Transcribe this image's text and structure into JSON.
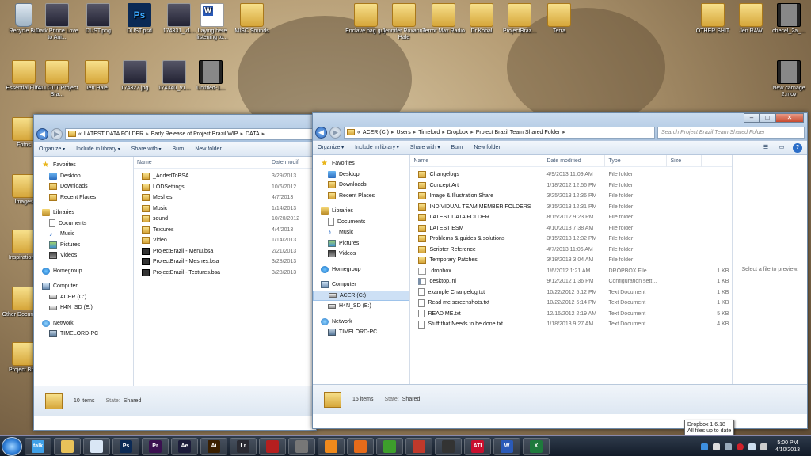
{
  "desktop": {
    "icons": [
      {
        "label": "Recycle Bin"
      },
      {
        "label": "Dark Prince Love to Ani..."
      },
      {
        "label": "DUST.png"
      },
      {
        "label": "DUST.psd"
      },
      {
        "label": "174331_v1..."
      },
      {
        "label": "Laying here listening to..."
      },
      {
        "label": "MISC Sounds"
      },
      {
        "label": "Enclave bag guy"
      },
      {
        "label": "Jennifer Roxanne Hale"
      },
      {
        "label": "Terror Max Radio"
      },
      {
        "label": "Dr.Kobal"
      },
      {
        "label": "ProjectBraz..."
      },
      {
        "label": "Terra"
      },
      {
        "label": "OTHER SHIT"
      },
      {
        "label": "Jen RAW"
      },
      {
        "label": "checel_2a_..."
      },
      {
        "label": "Essential Files"
      },
      {
        "label": "fALLOUT Project Bra..."
      },
      {
        "label": "Jen Hale"
      },
      {
        "label": "174327.jpg"
      },
      {
        "label": "174340_v1..."
      },
      {
        "label": "Untitled-1..."
      },
      {
        "label": "New carnage 2.mov"
      },
      {
        "label": "Fotos"
      },
      {
        "label": "Images"
      },
      {
        "label": "Inspiration..."
      },
      {
        "label": "Other Documents"
      },
      {
        "label": "Project Braz"
      }
    ],
    "psd_badge": "PSD",
    "psd_glyph": "Ps"
  },
  "left_window": {
    "address": [
      "«",
      "LATEST DATA FOLDER",
      "Early Release of Project Brazil WIP",
      "DATA"
    ],
    "toolbar": [
      "Organize",
      "Include in library",
      "Share with",
      "Burn",
      "New folder"
    ],
    "columns": [
      "Name",
      "Date modif"
    ],
    "nav": {
      "favorites": "Favorites",
      "fav_items": [
        "Desktop",
        "Downloads",
        "Recent Places"
      ],
      "libraries": "Libraries",
      "lib_items": [
        "Documents",
        "Music",
        "Pictures",
        "Videos"
      ],
      "homegroup": "Homegroup",
      "computer": "Computer",
      "comp_items": [
        "ACER (C:)",
        "H4N_SD (E:)"
      ],
      "network": "Network",
      "net_items": [
        "TIMELORD-PC"
      ]
    },
    "files": [
      {
        "name": "_AddedToBSA",
        "date": "3/29/2013",
        "kind": "folder"
      },
      {
        "name": "LODSettings",
        "date": "10/6/2012",
        "kind": "folder"
      },
      {
        "name": "Meshes",
        "date": "4/7/2013",
        "kind": "folder"
      },
      {
        "name": "Music",
        "date": "1/14/2013",
        "kind": "folder"
      },
      {
        "name": "sound",
        "date": "10/20/2012",
        "kind": "folder"
      },
      {
        "name": "Textures",
        "date": "4/4/2013",
        "kind": "folder"
      },
      {
        "name": "Video",
        "date": "1/14/2013",
        "kind": "folder"
      },
      {
        "name": "ProjectBrazil - Menu.bsa",
        "date": "2/21/2013",
        "kind": "bsa"
      },
      {
        "name": "ProjectBrazil - Meshes.bsa",
        "date": "3/28/2013",
        "kind": "bsa"
      },
      {
        "name": "ProjectBrazil - Textures.bsa",
        "date": "3/28/2013",
        "kind": "bsa"
      }
    ],
    "status": {
      "count": "10 items",
      "state_label": "State:",
      "state": "Shared"
    }
  },
  "right_window": {
    "address": [
      "«",
      "ACER (C:)",
      "Users",
      "Timelord",
      "Dropbox",
      "Project Brazil Team Shared Folder"
    ],
    "search_placeholder": "Search Project Brazil Team Shared Folder",
    "toolbar": [
      "Organize",
      "Include in library",
      "Share with",
      "Burn",
      "New folder"
    ],
    "columns": [
      "Name",
      "Date modified",
      "Type",
      "Size"
    ],
    "nav": {
      "favorites": "Favorites",
      "fav_items": [
        "Desktop",
        "Downloads",
        "Recent Places"
      ],
      "libraries": "Libraries",
      "lib_items": [
        "Documents",
        "Music",
        "Pictures",
        "Videos"
      ],
      "homegroup": "Homegroup",
      "computer": "Computer",
      "comp_items": [
        "ACER (C:)",
        "H4N_SD (E:)"
      ],
      "network": "Network",
      "net_items": [
        "TIMELORD-PC"
      ]
    },
    "files": [
      {
        "name": "Changelogs",
        "date": "4/9/2013 11:09 AM",
        "type": "File folder",
        "size": "",
        "kind": "folder"
      },
      {
        "name": "Concept Art",
        "date": "1/18/2012 12:56 PM",
        "type": "File folder",
        "size": "",
        "kind": "folder"
      },
      {
        "name": "Image & Illustration Share",
        "date": "3/25/2013 12:36 PM",
        "type": "File folder",
        "size": "",
        "kind": "folder"
      },
      {
        "name": "INDIVIDUAL TEAM MEMBER FOLDERS",
        "date": "3/15/2013 12:31 PM",
        "type": "File folder",
        "size": "",
        "kind": "folder"
      },
      {
        "name": "LATEST DATA FOLDER",
        "date": "8/15/2012 9:23 PM",
        "type": "File folder",
        "size": "",
        "kind": "folder"
      },
      {
        "name": "LATEST ESM",
        "date": "4/10/2013 7:38 AM",
        "type": "File folder",
        "size": "",
        "kind": "folder"
      },
      {
        "name": "Problems & guides & solutions",
        "date": "3/15/2013 12:32 PM",
        "type": "File folder",
        "size": "",
        "kind": "folder"
      },
      {
        "name": "Scripter Reference",
        "date": "4/7/2013 11:06 AM",
        "type": "File folder",
        "size": "",
        "kind": "folder"
      },
      {
        "name": "Temporary Patches",
        "date": "3/18/2013 3:04 AM",
        "type": "File folder",
        "size": "",
        "kind": "folder"
      },
      {
        "name": ".dropbox",
        "date": "1/6/2012 1:21 AM",
        "type": "DROPBOX File",
        "size": "1 KB",
        "kind": "dropbox"
      },
      {
        "name": "desktop.ini",
        "date": "9/12/2012 1:36 PM",
        "type": "Configuration sett...",
        "size": "1 KB",
        "kind": "ini"
      },
      {
        "name": "example Changelog.txt",
        "date": "10/22/2012 5:12 PM",
        "type": "Text Document",
        "size": "1 KB",
        "kind": "txt"
      },
      {
        "name": "Read me screenshots.txt",
        "date": "10/22/2012 5:14 PM",
        "type": "Text Document",
        "size": "1 KB",
        "kind": "txt"
      },
      {
        "name": "READ ME.txt",
        "date": "12/16/2012 2:19 AM",
        "type": "Text Document",
        "size": "5 KB",
        "kind": "txt"
      },
      {
        "name": "Stuff that Needs to be done.txt",
        "date": "1/18/2013 9:27 AM",
        "type": "Text Document",
        "size": "4 KB",
        "kind": "txt"
      }
    ],
    "preview_text": "Select a file to preview.",
    "status": {
      "count": "15 items",
      "state_label": "State:",
      "state": "Shared"
    }
  },
  "taskbar": {
    "buttons": [
      {
        "name": "talk",
        "text": "talk",
        "color": "#3fa0e8"
      },
      {
        "name": "explorer",
        "text": "",
        "color": "#e8c25a"
      },
      {
        "name": "notepad",
        "text": "",
        "color": "#d9e6f5"
      },
      {
        "name": "photoshop",
        "text": "Ps",
        "color": "#0b2a55"
      },
      {
        "name": "premiere",
        "text": "Pr",
        "color": "#3b1050"
      },
      {
        "name": "after-effects",
        "text": "Ae",
        "color": "#1c1b3a"
      },
      {
        "name": "illustrator",
        "text": "Ai",
        "color": "#3a1f00"
      },
      {
        "name": "lightroom",
        "text": "Lr",
        "color": "#2a2a32"
      },
      {
        "name": "app-red",
        "text": "",
        "color": "#b51f1f"
      },
      {
        "name": "app-gray",
        "text": "",
        "color": "#777777"
      },
      {
        "name": "vlc",
        "text": "",
        "color": "#f08a1c"
      },
      {
        "name": "firefox",
        "text": "",
        "color": "#e66b1a"
      },
      {
        "name": "utorrent",
        "text": "",
        "color": "#3d9e2c"
      },
      {
        "name": "toolbox",
        "text": "",
        "color": "#c0392b"
      },
      {
        "name": "app-dark",
        "text": "",
        "color": "#333333"
      },
      {
        "name": "ati",
        "text": "ATI",
        "color": "#c8102e"
      },
      {
        "name": "word",
        "text": "W",
        "color": "#2a5ab8"
      },
      {
        "name": "excel",
        "text": "X",
        "color": "#1e7a3c"
      }
    ],
    "clock_time": "5:00 PM",
    "clock_date": "4/10/2013"
  },
  "tooltip": {
    "line1": "Dropbox 1.6.18",
    "line2": "All files up to date"
  }
}
